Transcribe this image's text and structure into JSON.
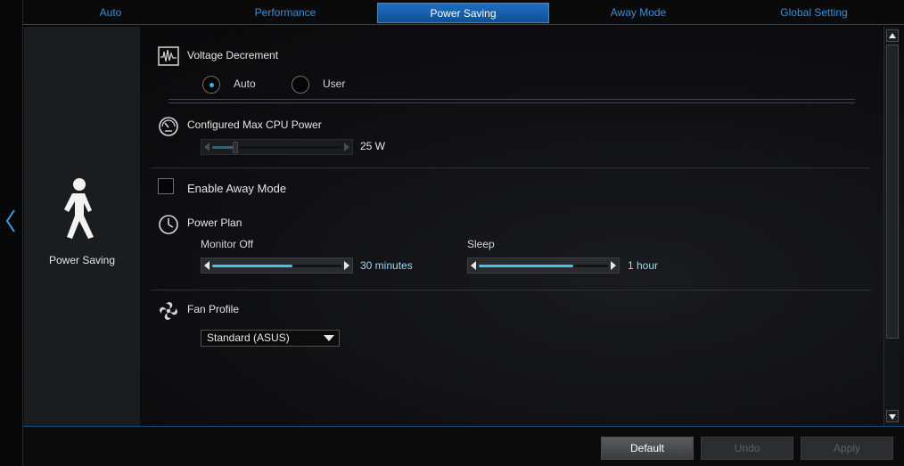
{
  "tabs": [
    {
      "label": "Auto"
    },
    {
      "label": "Performance"
    },
    {
      "label": "Power Saving"
    },
    {
      "label": "Away Mode"
    },
    {
      "label": "Global Setting"
    }
  ],
  "mode_panel": {
    "label": "Power Saving"
  },
  "voltage": {
    "title": "Voltage Decrement",
    "options": [
      "Auto",
      "User"
    ],
    "selected": "Auto"
  },
  "cpu_power": {
    "title": "Configured Max CPU Power",
    "value": "25 W",
    "level_fraction": 0.18
  },
  "away_mode": {
    "label": "Enable Away Mode",
    "checked": false
  },
  "power_plan": {
    "title": "Power Plan",
    "monitor_off": {
      "label": "Monitor Off",
      "value": "30 minutes",
      "level_fraction": 0.62
    },
    "sleep": {
      "label": "Sleep",
      "value": "1 hour",
      "level_fraction": 0.73
    }
  },
  "fan_profile": {
    "title": "Fan Profile",
    "selected": "Standard (ASUS)"
  },
  "buttons": {
    "default": "Default",
    "undo": "Undo",
    "apply": "Apply"
  },
  "colors": {
    "accent": "#1f6fbf",
    "tab_text": "#3b8fd6",
    "slider_fill": "#3ec6f0"
  },
  "icons": {
    "voltage": "waveform-icon",
    "cpu": "gauge-icon",
    "power_plan": "clock-icon",
    "fan": "fan-icon",
    "mode": "walking-person-icon"
  }
}
